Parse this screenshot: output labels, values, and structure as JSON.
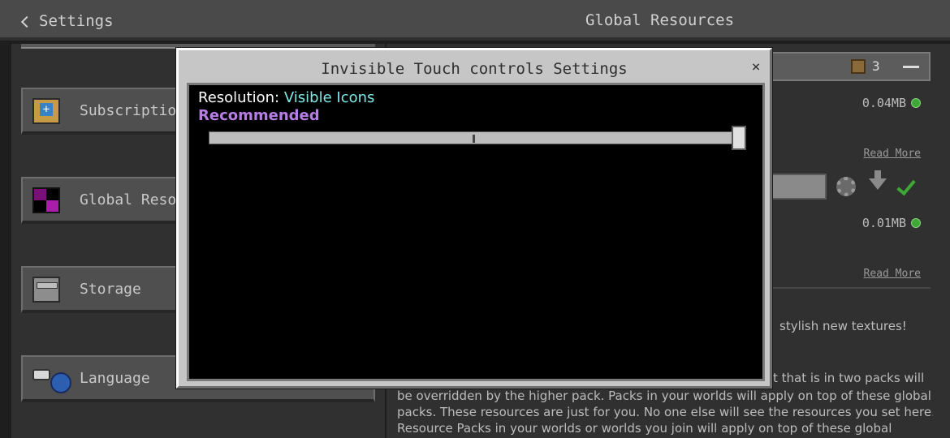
{
  "topbar": {
    "back_label": "Settings",
    "title": "Global Resources"
  },
  "sidebar": {
    "items": [
      {
        "label": "Subscriptions",
        "icon": "subscription-icon"
      },
      {
        "label": "Global Resources",
        "icon": "global-resources-icon"
      },
      {
        "label": "Storage",
        "icon": "storage-icon"
      },
      {
        "label": "Language",
        "icon": "language-icon"
      }
    ]
  },
  "packs": {
    "count": "3",
    "items": [
      {
        "size": "0.04MB",
        "read_more": "Read More"
      },
      {
        "size": "0.01MB",
        "read_more": "Read More"
      }
    ]
  },
  "description": {
    "lines": [
      "stylish new textures!",
      "t that is in two packs will",
      "be overridden by the higher pack. Packs in your worlds will apply on top of these global",
      "packs. These resources are just for you. No one else will see the resources you set here.",
      "Resource Packs in your worlds or worlds you join will apply on top of these global"
    ]
  },
  "modal": {
    "title": "Invisible Touch controls Settings",
    "close_symbol": "×",
    "resolution_label": "Resolution:",
    "resolution_value": "Visible Icons",
    "recommended_label": "Recommended",
    "slider_value": 1.0
  },
  "colors": {
    "accent_cyan": "#7fe6e6",
    "recommended_purple": "#b77ee6",
    "status_green": "#3ea836"
  }
}
